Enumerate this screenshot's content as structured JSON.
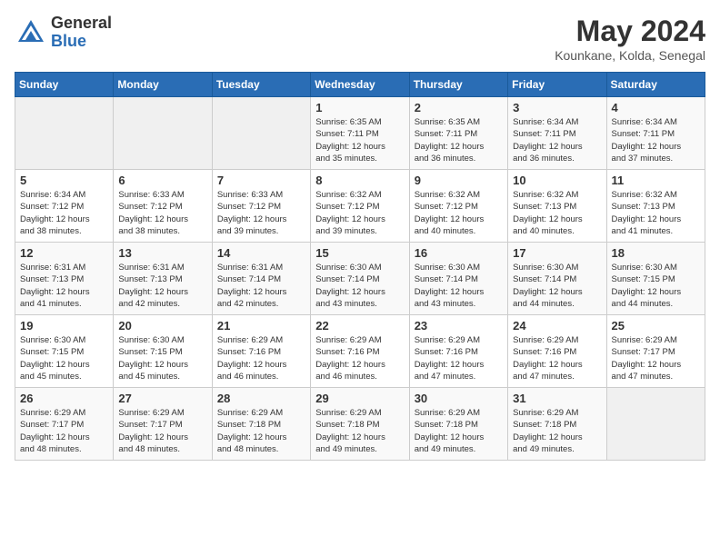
{
  "header": {
    "logo_general": "General",
    "logo_blue": "Blue",
    "month_title": "May 2024",
    "location": "Kounkane, Kolda, Senegal"
  },
  "days_of_week": [
    "Sunday",
    "Monday",
    "Tuesday",
    "Wednesday",
    "Thursday",
    "Friday",
    "Saturday"
  ],
  "weeks": [
    [
      {
        "day": "",
        "info": ""
      },
      {
        "day": "",
        "info": ""
      },
      {
        "day": "",
        "info": ""
      },
      {
        "day": "1",
        "info": "Sunrise: 6:35 AM\nSunset: 7:11 PM\nDaylight: 12 hours\nand 35 minutes."
      },
      {
        "day": "2",
        "info": "Sunrise: 6:35 AM\nSunset: 7:11 PM\nDaylight: 12 hours\nand 36 minutes."
      },
      {
        "day": "3",
        "info": "Sunrise: 6:34 AM\nSunset: 7:11 PM\nDaylight: 12 hours\nand 36 minutes."
      },
      {
        "day": "4",
        "info": "Sunrise: 6:34 AM\nSunset: 7:11 PM\nDaylight: 12 hours\nand 37 minutes."
      }
    ],
    [
      {
        "day": "5",
        "info": "Sunrise: 6:34 AM\nSunset: 7:12 PM\nDaylight: 12 hours\nand 38 minutes."
      },
      {
        "day": "6",
        "info": "Sunrise: 6:33 AM\nSunset: 7:12 PM\nDaylight: 12 hours\nand 38 minutes."
      },
      {
        "day": "7",
        "info": "Sunrise: 6:33 AM\nSunset: 7:12 PM\nDaylight: 12 hours\nand 39 minutes."
      },
      {
        "day": "8",
        "info": "Sunrise: 6:32 AM\nSunset: 7:12 PM\nDaylight: 12 hours\nand 39 minutes."
      },
      {
        "day": "9",
        "info": "Sunrise: 6:32 AM\nSunset: 7:12 PM\nDaylight: 12 hours\nand 40 minutes."
      },
      {
        "day": "10",
        "info": "Sunrise: 6:32 AM\nSunset: 7:13 PM\nDaylight: 12 hours\nand 40 minutes."
      },
      {
        "day": "11",
        "info": "Sunrise: 6:32 AM\nSunset: 7:13 PM\nDaylight: 12 hours\nand 41 minutes."
      }
    ],
    [
      {
        "day": "12",
        "info": "Sunrise: 6:31 AM\nSunset: 7:13 PM\nDaylight: 12 hours\nand 41 minutes."
      },
      {
        "day": "13",
        "info": "Sunrise: 6:31 AM\nSunset: 7:13 PM\nDaylight: 12 hours\nand 42 minutes."
      },
      {
        "day": "14",
        "info": "Sunrise: 6:31 AM\nSunset: 7:14 PM\nDaylight: 12 hours\nand 42 minutes."
      },
      {
        "day": "15",
        "info": "Sunrise: 6:30 AM\nSunset: 7:14 PM\nDaylight: 12 hours\nand 43 minutes."
      },
      {
        "day": "16",
        "info": "Sunrise: 6:30 AM\nSunset: 7:14 PM\nDaylight: 12 hours\nand 43 minutes."
      },
      {
        "day": "17",
        "info": "Sunrise: 6:30 AM\nSunset: 7:14 PM\nDaylight: 12 hours\nand 44 minutes."
      },
      {
        "day": "18",
        "info": "Sunrise: 6:30 AM\nSunset: 7:15 PM\nDaylight: 12 hours\nand 44 minutes."
      }
    ],
    [
      {
        "day": "19",
        "info": "Sunrise: 6:30 AM\nSunset: 7:15 PM\nDaylight: 12 hours\nand 45 minutes."
      },
      {
        "day": "20",
        "info": "Sunrise: 6:30 AM\nSunset: 7:15 PM\nDaylight: 12 hours\nand 45 minutes."
      },
      {
        "day": "21",
        "info": "Sunrise: 6:29 AM\nSunset: 7:16 PM\nDaylight: 12 hours\nand 46 minutes."
      },
      {
        "day": "22",
        "info": "Sunrise: 6:29 AM\nSunset: 7:16 PM\nDaylight: 12 hours\nand 46 minutes."
      },
      {
        "day": "23",
        "info": "Sunrise: 6:29 AM\nSunset: 7:16 PM\nDaylight: 12 hours\nand 47 minutes."
      },
      {
        "day": "24",
        "info": "Sunrise: 6:29 AM\nSunset: 7:16 PM\nDaylight: 12 hours\nand 47 minutes."
      },
      {
        "day": "25",
        "info": "Sunrise: 6:29 AM\nSunset: 7:17 PM\nDaylight: 12 hours\nand 47 minutes."
      }
    ],
    [
      {
        "day": "26",
        "info": "Sunrise: 6:29 AM\nSunset: 7:17 PM\nDaylight: 12 hours\nand 48 minutes."
      },
      {
        "day": "27",
        "info": "Sunrise: 6:29 AM\nSunset: 7:17 PM\nDaylight: 12 hours\nand 48 minutes."
      },
      {
        "day": "28",
        "info": "Sunrise: 6:29 AM\nSunset: 7:18 PM\nDaylight: 12 hours\nand 48 minutes."
      },
      {
        "day": "29",
        "info": "Sunrise: 6:29 AM\nSunset: 7:18 PM\nDaylight: 12 hours\nand 49 minutes."
      },
      {
        "day": "30",
        "info": "Sunrise: 6:29 AM\nSunset: 7:18 PM\nDaylight: 12 hours\nand 49 minutes."
      },
      {
        "day": "31",
        "info": "Sunrise: 6:29 AM\nSunset: 7:18 PM\nDaylight: 12 hours\nand 49 minutes."
      },
      {
        "day": "",
        "info": ""
      }
    ]
  ]
}
